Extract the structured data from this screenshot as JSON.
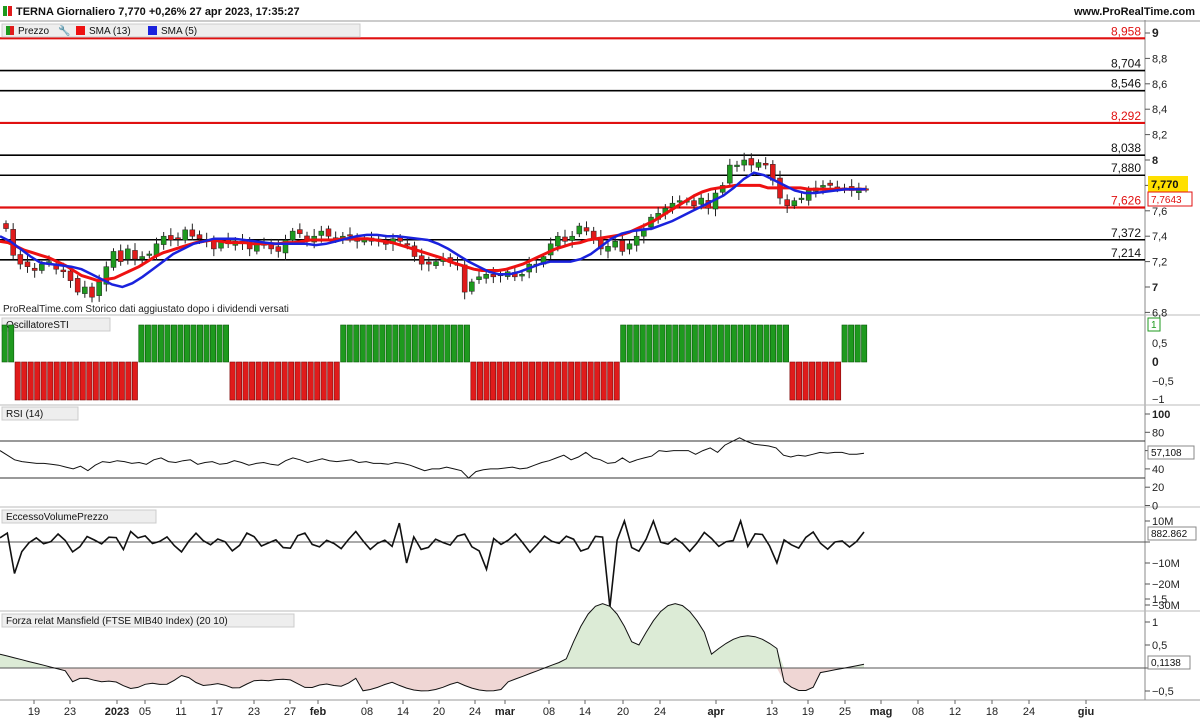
{
  "header": {
    "title": "TERNA Giornaliero 7,770 +0,26% 27 apr 2023, 17:35:27",
    "site": "www.ProRealTime.com"
  },
  "colors": {
    "up": "#1e9a1e",
    "down": "#e01b1b",
    "sma13": "#ee1111",
    "sma5": "#1a22dd",
    "support_red": "#e01010",
    "support_black": "#000000"
  },
  "icons": [
    "candlestick-icon",
    "wrench-icon",
    "sma13-swatch-icon",
    "sma5-swatch-icon"
  ],
  "x_axis": {
    "labels": [
      "19",
      "23",
      "2023",
      "05",
      "11",
      "17",
      "23",
      "27",
      "feb",
      "08",
      "14",
      "20",
      "24",
      "mar",
      "08",
      "14",
      "20",
      "24",
      "apr",
      "13",
      "19",
      "25",
      "mag",
      "08",
      "12",
      "18",
      "24",
      "giu"
    ]
  },
  "price_panel": {
    "legend": {
      "price": "Prezzo",
      "sma13": "SMA (13)",
      "sma5": "SMA (5)"
    },
    "y_ticks": [
      "9",
      "8,8",
      "8,6",
      "8,4",
      "8,2",
      "8",
      "7,8",
      "7,6",
      "7,4",
      "7,2",
      "7",
      "6,8"
    ],
    "levels": [
      {
        "value": 8.958,
        "label": "8,958",
        "color": "red"
      },
      {
        "value": 8.704,
        "label": "8,704",
        "color": "black"
      },
      {
        "value": 8.546,
        "label": "8,546",
        "color": "black"
      },
      {
        "value": 8.292,
        "label": "8,292",
        "color": "red"
      },
      {
        "value": 8.038,
        "label": "8,038",
        "color": "black"
      },
      {
        "value": 7.88,
        "label": "7,880",
        "color": "black"
      },
      {
        "value": 7.626,
        "label": "7,626",
        "color": "red"
      },
      {
        "value": 7.372,
        "label": "7,372",
        "color": "black"
      },
      {
        "value": 7.214,
        "label": "7,214",
        "color": "black"
      }
    ],
    "last_price": "7,770",
    "last_sma": "7,7643",
    "note": "ProRealTime.com Storico dati aggiustato dopo i dividendi versati"
  },
  "sti_panel": {
    "title": "OscillatoreSTI",
    "y_ticks": [
      "1",
      "0,5",
      "0",
      "−0,5",
      "−1"
    ],
    "last": "1"
  },
  "rsi_panel": {
    "title": "RSI (14)",
    "y_ticks": [
      "100",
      "80",
      "60",
      "40",
      "20",
      "0"
    ],
    "last": "57,108"
  },
  "vol_panel": {
    "title": "EccessoVolumePrezzo",
    "y_ticks": [
      "10M",
      "0",
      "−10M",
      "−20M",
      "−30M"
    ],
    "last": "882.862"
  },
  "mans_panel": {
    "title": "Forza relat Mansfield (FTSE MIB40 Index) (20 10)",
    "y_ticks": [
      "1,5",
      "1",
      "0,5",
      "0",
      "−0,5"
    ],
    "last": "0,1138"
  },
  "chart_data": {
    "type": "line",
    "symbol": "TERNA",
    "series": [
      {
        "name": "Prezzo",
        "close": [
          7.46,
          7.25,
          7.18,
          7.16,
          7.13,
          7.18,
          7.2,
          7.14,
          7.12,
          7.05,
          6.96,
          7.0,
          6.92,
          7.04,
          7.16,
          7.28,
          7.2,
          7.3,
          7.22,
          7.24,
          7.26,
          7.34,
          7.4,
          7.37,
          7.38,
          7.45,
          7.4,
          7.38,
          7.37,
          7.3,
          7.36,
          7.34,
          7.36,
          7.34,
          7.3,
          7.34,
          7.34,
          7.3,
          7.28,
          7.37,
          7.44,
          7.42,
          7.36,
          7.4,
          7.44,
          7.4,
          7.38,
          7.4,
          7.4,
          7.36,
          7.38,
          7.36,
          7.36,
          7.34,
          7.38,
          7.36,
          7.33,
          7.24,
          7.18,
          7.18,
          7.2,
          7.22,
          7.2,
          7.18,
          6.96,
          7.04,
          7.08,
          7.1,
          7.08,
          7.1,
          7.12,
          7.08,
          7.1,
          7.18,
          7.18,
          7.24,
          7.34,
          7.4,
          7.36,
          7.4,
          7.48,
          7.44,
          7.38,
          7.3,
          7.32,
          7.36,
          7.28,
          7.34,
          7.4,
          7.46,
          7.55,
          7.58,
          7.62,
          7.66,
          7.68,
          7.68,
          7.64,
          7.7,
          7.62,
          7.74,
          7.8,
          7.96,
          7.96,
          8.0,
          7.96,
          7.98,
          7.96,
          7.84,
          7.7,
          7.64,
          7.68,
          7.7,
          7.76,
          7.78,
          7.8,
          7.8,
          7.78,
          7.78,
          7.76,
          7.78,
          7.77
        ]
      },
      {
        "name": "SMA (13)",
        "values": [
          7.36,
          7.35,
          7.32,
          7.29,
          7.27,
          7.25,
          7.23,
          7.2,
          7.17,
          7.13,
          7.09,
          7.07,
          7.05,
          7.06,
          7.07,
          7.1,
          7.13,
          7.16,
          7.2,
          7.24,
          7.27,
          7.29,
          7.31,
          7.33,
          7.35,
          7.36,
          7.37,
          7.36,
          7.35,
          7.35,
          7.35,
          7.34,
          7.34,
          7.34,
          7.34,
          7.35,
          7.35,
          7.36,
          7.37,
          7.37,
          7.37,
          7.37,
          7.38,
          7.38,
          7.38,
          7.38,
          7.37,
          7.36,
          7.35,
          7.33,
          7.31,
          7.29,
          7.27,
          7.25,
          7.23,
          7.2,
          7.18,
          7.16,
          7.14,
          7.13,
          7.13,
          7.13,
          7.14,
          7.16,
          7.18,
          7.21,
          7.24,
          7.27,
          7.3,
          7.32,
          7.34,
          7.35,
          7.37,
          7.38,
          7.39,
          7.4,
          7.41,
          7.43,
          7.46,
          7.49,
          7.52,
          7.56,
          7.6,
          7.64,
          7.68,
          7.72,
          7.75,
          7.77,
          7.78,
          7.79,
          7.8,
          7.8,
          7.8,
          7.8,
          7.78,
          7.78,
          7.78,
          7.78,
          7.78,
          7.77,
          7.77,
          7.77,
          7.77,
          7.77,
          7.77,
          7.77,
          7.77
        ]
      },
      {
        "name": "SMA (5)",
        "values": [
          7.4,
          7.36,
          7.3,
          7.24,
          7.19,
          7.18,
          7.17,
          7.16,
          7.14,
          7.1,
          7.06,
          7.02,
          7.0,
          7.03,
          7.08,
          7.14,
          7.2,
          7.26,
          7.3,
          7.34,
          7.36,
          7.38,
          7.38,
          7.38,
          7.37,
          7.36,
          7.35,
          7.34,
          7.34,
          7.34,
          7.34,
          7.33,
          7.34,
          7.36,
          7.38,
          7.4,
          7.41,
          7.41,
          7.4,
          7.4,
          7.39,
          7.38,
          7.37,
          7.34,
          7.3,
          7.25,
          7.2,
          7.16,
          7.12,
          7.1,
          7.1,
          7.12,
          7.15,
          7.18,
          7.2,
          7.2,
          7.2,
          7.22,
          7.26,
          7.32,
          7.38,
          7.42,
          7.44,
          7.45,
          7.46,
          7.49,
          7.52,
          7.56,
          7.6,
          7.64,
          7.68,
          7.72,
          7.78,
          7.85,
          7.9,
          7.88,
          7.84,
          7.8,
          7.76,
          7.74,
          7.74,
          7.75,
          7.76,
          7.77,
          7.77,
          7.77
        ]
      }
    ],
    "sti_values": [
      1,
      1,
      -1,
      -1,
      -1,
      -1,
      -1,
      -1,
      -1,
      -1,
      -1,
      -1,
      -1,
      -1,
      -1,
      -1,
      -1,
      -1,
      -1,
      -1,
      -1,
      1,
      1,
      1,
      1,
      1,
      1,
      1,
      1,
      1,
      1,
      1,
      1,
      1,
      1,
      -1,
      -1,
      -1,
      -1,
      -1,
      -1,
      -1,
      -1,
      -1,
      -1,
      -1,
      -1,
      -1,
      -1,
      -1,
      -1,
      -1,
      1,
      1,
      1,
      1,
      1,
      1,
      1,
      1,
      1,
      1,
      1,
      1,
      1,
      1,
      1,
      1,
      1,
      1,
      1,
      1,
      -1,
      -1,
      -1,
      -1,
      -1,
      -1,
      -1,
      -1,
      -1,
      -1,
      -1,
      -1,
      -1,
      -1,
      -1,
      -1,
      -1,
      -1,
      -1,
      -1,
      -1,
      -1,
      -1,
      1,
      1,
      1,
      1,
      1,
      1,
      1,
      1,
      1,
      1,
      1,
      1,
      1,
      1,
      1,
      1,
      1,
      1,
      1,
      1,
      1,
      1,
      1,
      1,
      1,
      1,
      -1,
      -1,
      -1,
      -1,
      -1,
      -1,
      -1,
      -1,
      1,
      1,
      1,
      1
    ],
    "rsi_values": [
      60,
      55,
      50,
      48,
      47,
      46,
      46,
      45,
      44,
      42,
      40,
      43,
      38,
      44,
      48,
      47,
      49,
      48,
      46,
      47,
      45,
      50,
      52,
      48,
      47,
      49,
      50,
      45,
      47,
      48,
      45,
      46,
      49,
      47,
      44,
      46,
      47,
      45,
      44,
      49,
      52,
      50,
      47,
      49,
      51,
      49,
      48,
      49,
      50,
      47,
      48,
      46,
      46,
      45,
      47,
      46,
      44,
      41,
      38,
      40,
      40,
      42,
      40,
      38,
      30,
      37,
      39,
      40,
      40,
      41,
      42,
      40,
      41,
      44,
      47,
      49,
      52,
      55,
      50,
      53,
      58,
      52,
      50,
      46,
      47,
      52,
      47,
      50,
      52,
      54,
      60,
      59,
      60,
      60,
      60,
      56,
      60,
      63,
      58,
      66,
      70,
      74,
      70,
      67,
      66,
      65,
      63,
      55,
      53,
      55,
      54,
      56,
      58,
      57,
      58,
      58,
      56,
      56,
      57
    ]
  }
}
